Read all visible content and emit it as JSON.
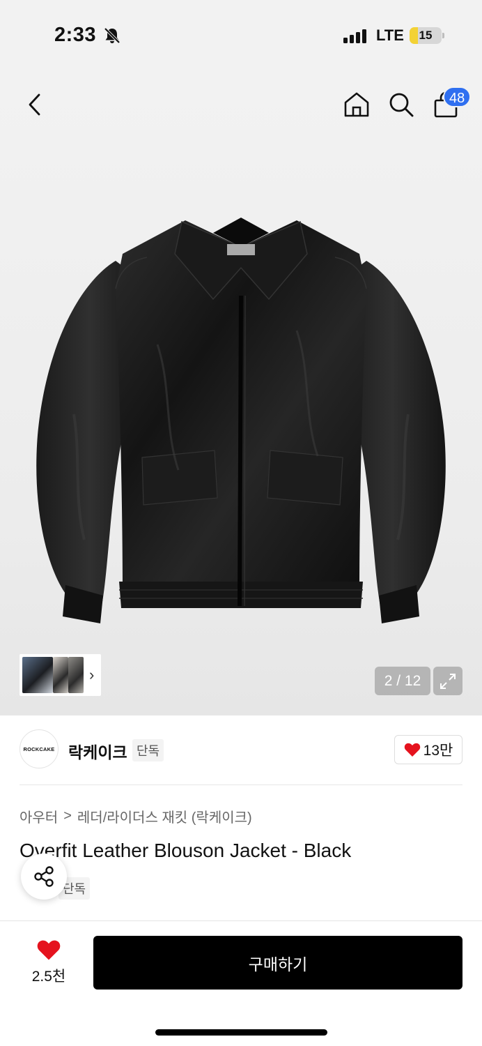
{
  "status": {
    "time": "2:33",
    "network": "LTE",
    "battery": "15",
    "battery_level": 0.15
  },
  "header": {
    "cart_count": "48"
  },
  "gallery": {
    "pager": "2 / 12",
    "thumb_arrow": "›"
  },
  "brand": {
    "logo_text": "ROCKCAKE",
    "name": "락케이크",
    "tag": "단독",
    "likes": "13만"
  },
  "breadcrumb": {
    "category": "아우터",
    "separator": ">",
    "subcategory": "레더/라이더스 재킷 (락케이크)"
  },
  "product": {
    "title": "Overfit Leather Blouson Jacket - Black",
    "tag": "단독"
  },
  "bottom": {
    "wish_count": "2.5천",
    "buy_label": "구매하기"
  },
  "colors": {
    "accent_blue": "#2f6ff0",
    "heart_red": "#e5131e",
    "buy_black": "#000000"
  },
  "icons": [
    "back-icon",
    "home-icon",
    "search-icon",
    "cart-icon",
    "bell-off-icon",
    "expand-icon",
    "share-icon",
    "heart-icon"
  ]
}
